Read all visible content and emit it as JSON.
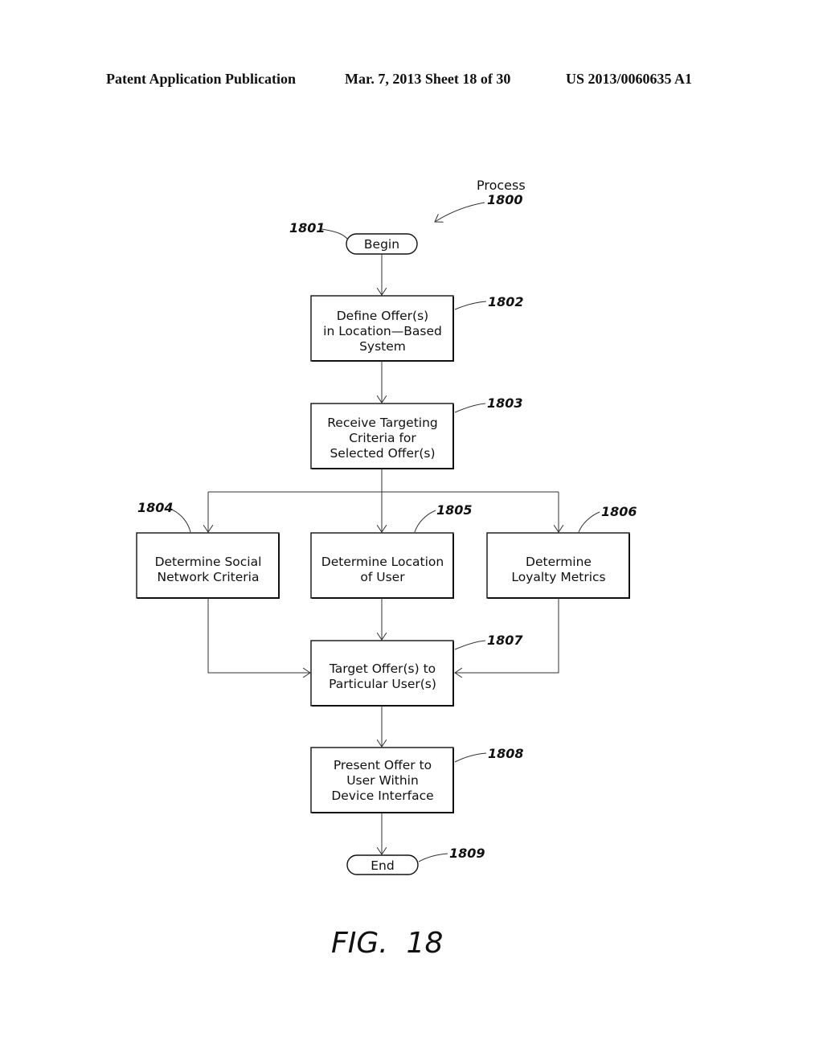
{
  "header": {
    "left": "Patent Application Publication",
    "middle": "Mar. 7, 2013   Sheet 18 of 30",
    "right": "US 2013/0060635 A1"
  },
  "process": {
    "label": "Process",
    "ref": "1800"
  },
  "nodes": {
    "begin": {
      "ref": "1801",
      "lines": [
        "Begin"
      ]
    },
    "n1802": {
      "ref": "1802",
      "lines": [
        "Define Offer(s)",
        "in Location—Based",
        "System"
      ]
    },
    "n1803": {
      "ref": "1803",
      "lines": [
        "Receive Targeting",
        "Criteria for",
        "Selected Offer(s)"
      ]
    },
    "n1804": {
      "ref": "1804",
      "lines": [
        "Determine Social",
        "Network Criteria"
      ]
    },
    "n1805": {
      "ref": "1805",
      "lines": [
        "Determine Location",
        "of User"
      ]
    },
    "n1806": {
      "ref": "1806",
      "lines": [
        "Determine",
        "Loyalty Metrics"
      ]
    },
    "n1807": {
      "ref": "1807",
      "lines": [
        "Target Offer(s) to",
        "Particular User(s)"
      ]
    },
    "n1808": {
      "ref": "1808",
      "lines": [
        "Present Offer to",
        "User Within",
        "Device Interface"
      ]
    },
    "end": {
      "ref": "1809",
      "lines": [
        "End"
      ]
    }
  },
  "figure_label": "FIG.  18"
}
